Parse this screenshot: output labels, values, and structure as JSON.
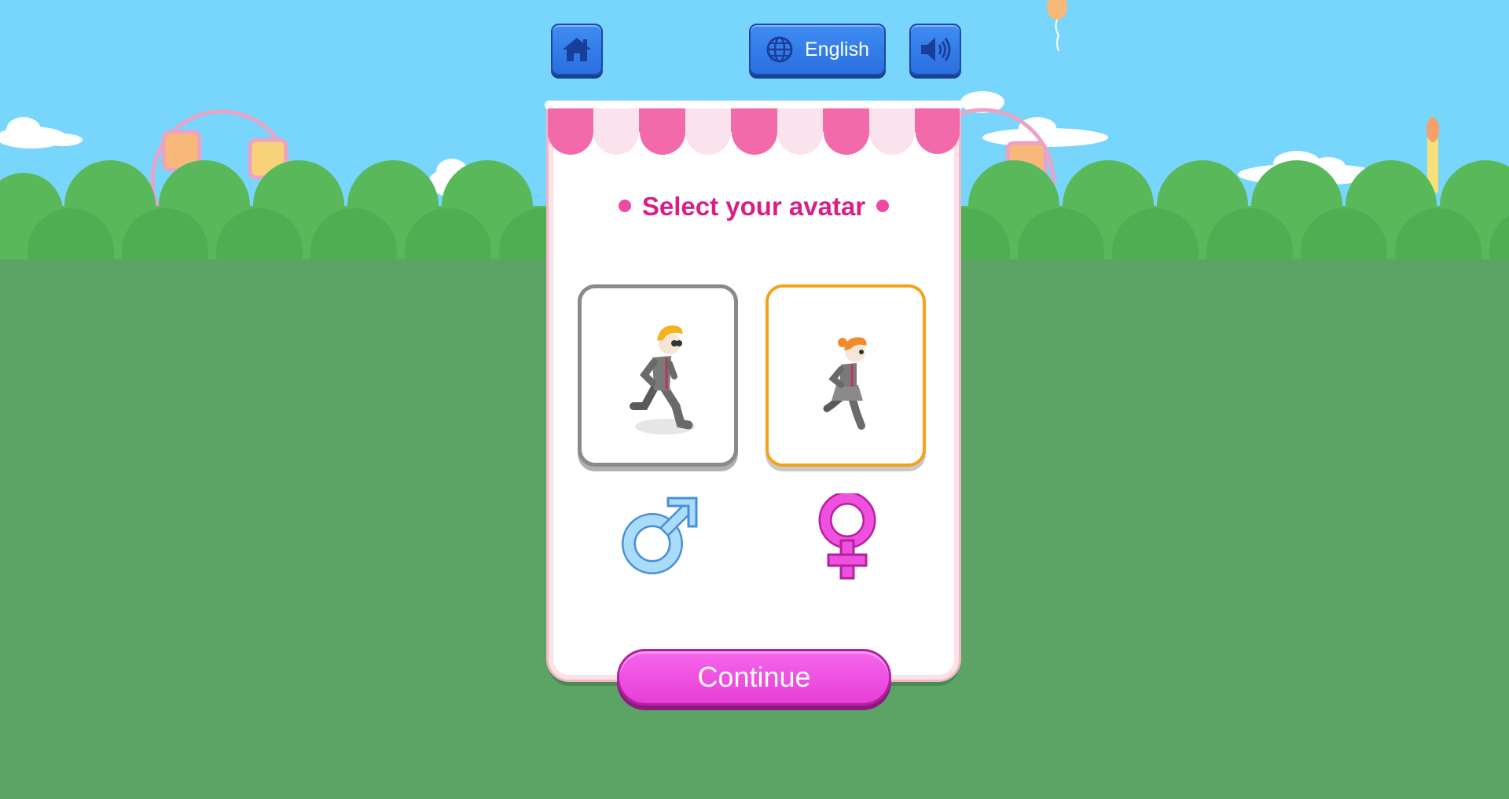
{
  "toolbar": {
    "home_icon": "home-icon",
    "language_icon": "globe-icon",
    "language_label": "English",
    "sound_icon": "speaker-icon"
  },
  "card": {
    "title": "Select your avatar",
    "avatars": [
      {
        "id": "male",
        "icon": "running-boy-avatar",
        "selected": false,
        "gender_icon": "male-symbol-icon"
      },
      {
        "id": "female",
        "icon": "running-girl-avatar",
        "selected": true,
        "gender_icon": "female-symbol-icon"
      }
    ],
    "continue_label": "Continue"
  },
  "colors": {
    "sky": "#78d5fb",
    "grass": "#5ca366",
    "accent_pink": "#d81f86",
    "button_blue": "#2a6fe0",
    "selected_border": "#f5a21a",
    "continue_pink": "#f055e3"
  }
}
